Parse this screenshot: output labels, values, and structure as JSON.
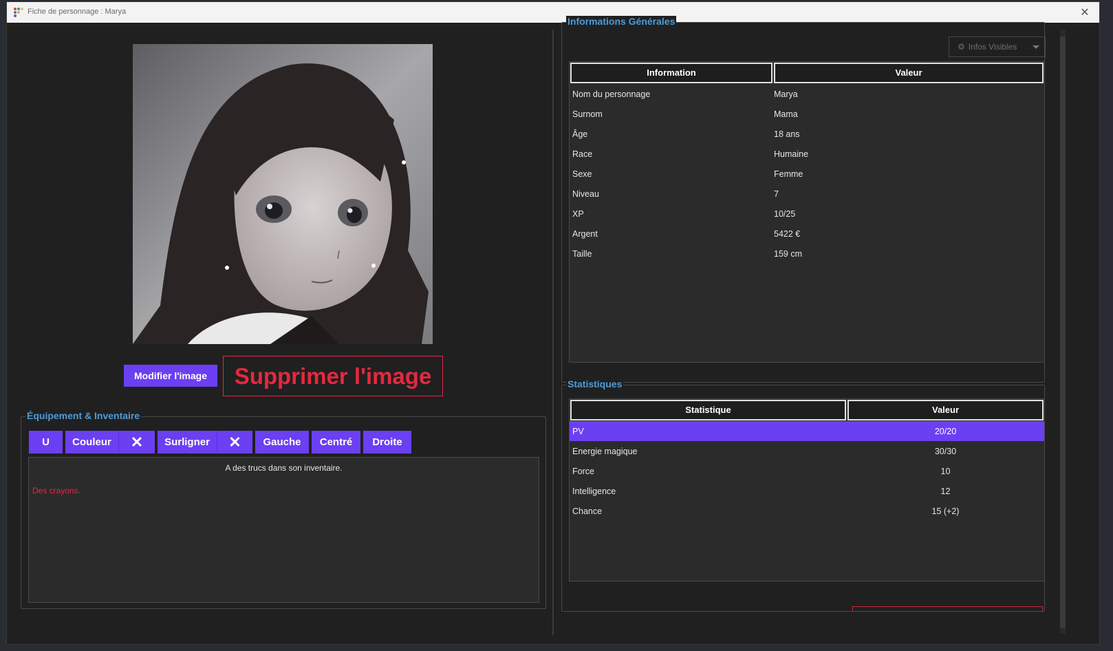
{
  "window": {
    "title": "Fiche de personnage : Marya"
  },
  "portrait": {
    "alt": "character-portrait"
  },
  "image_buttons": {
    "modify": "Modifier l'image",
    "delete": "Supprimer l'image"
  },
  "inventory": {
    "title": "Équipement & Inventaire",
    "toolbar": [
      "U",
      "Couleur",
      "✕",
      "Surligner",
      "✕",
      "Gauche",
      "Centré",
      "Droite"
    ],
    "line1": "A des trucs dans son inventaire.",
    "line2": "Des crayons."
  },
  "general_info": {
    "title": "Informations Générales",
    "visible_button": "Infos Visibles",
    "headers": [
      "Information",
      "Valeur"
    ],
    "rows": [
      [
        "Nom du personnage",
        "Marya"
      ],
      [
        "Surnom",
        "Mama"
      ],
      [
        "Âge",
        "18 ans"
      ],
      [
        "Race",
        "Humaine"
      ],
      [
        "Sexe",
        "Femme"
      ],
      [
        "Niveau",
        "7"
      ],
      [
        "XP",
        "10/25"
      ],
      [
        "Argent",
        "5422 €"
      ],
      [
        "Taille",
        "159 cm"
      ]
    ]
  },
  "stats": {
    "title": "Statistiques",
    "headers": [
      "Statistique",
      "Valeur"
    ],
    "rows": [
      [
        "PV",
        "20/20"
      ],
      [
        "Energie magique",
        "30/30"
      ],
      [
        "Force",
        "10"
      ],
      [
        "Intelligence",
        "12"
      ],
      [
        "Chance",
        "15 (+2)"
      ]
    ],
    "selected_row": 0
  },
  "colors": {
    "accent": "#6b3ff2",
    "danger": "#e4293f",
    "group_title": "#4d9cd9"
  }
}
